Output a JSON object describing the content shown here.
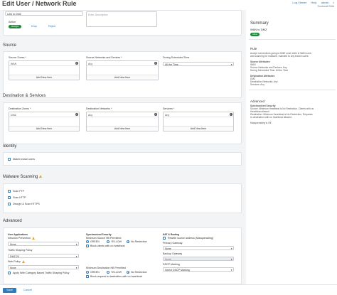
{
  "header": {
    "title": "Edit User / Network Rule",
    "links": [
      "Log Viewer",
      "Help",
      "admin"
    ],
    "subtitle": "Sonicwall SMA"
  },
  "top": {
    "description_placeholder": "Enter Description",
    "name_value": "LAN to DMZ",
    "action_label": "Action",
    "actions": [
      "Accept",
      "Drop",
      "Reject"
    ]
  },
  "source": {
    "title": "Source",
    "zones_label": "Source Zones *",
    "zones_value": "WAN",
    "networks_label": "Source Networks and Devices *",
    "networks_value": "Any",
    "schedule_label": "During Scheduled Time",
    "schedule_value": "All the Time",
    "add_item": "Add New Item"
  },
  "destination": {
    "title": "Destination & Services",
    "zones_label": "Destination Zones *",
    "zones_value": "DMZ",
    "networks_label": "Destination Networks *",
    "networks_value": "Any",
    "services_label": "Services *",
    "services_value": "Any",
    "add_item": "Add New Item"
  },
  "identity": {
    "title": "Identity",
    "match_label": "Match known users"
  },
  "malware": {
    "title": "Malware Scanning",
    "items": [
      "Scan FTP",
      "Scan HTTP",
      "Decrypt & Scan HTTPS"
    ]
  },
  "advanced": {
    "title": "Advanced",
    "user_apps": "User Applications",
    "intrusion_label": "Intrusion Prevention",
    "intrusion_value": "None",
    "traffic_label": "Traffic Shaping Policy",
    "traffic_value": "DMZ 20",
    "web_label": "Web Policy",
    "web_value": "None",
    "apply_web": "Apply Web Category Based Traffic Shaping Policy",
    "sync_security": "Synchronized Security",
    "min_source": "Minimum Source HB Permitted",
    "min_dest": "Minimum Destination HB Permitted",
    "hb_options": [
      "GREEN",
      "YELLOW",
      "No Restriction"
    ],
    "block_clients": "Block clients with no heartbeat",
    "block_request": "Block request to destination with no heartbeat",
    "nat_routing": "NAT & Routing",
    "rewrite": "Rewrite source address (Masquerading)",
    "primary_gw_label": "Primary Gateway",
    "primary_gw_value": "None",
    "backup_gw_label": "Backup Gateway",
    "backup_gw_value": "None",
    "dscp_label": "DSCP Marking",
    "dscp_value": "Select DSCP Marking"
  },
  "summary": {
    "title": "Summary",
    "name": "WAN to DMZ",
    "badge": "Allow",
    "rule_title": "Rule",
    "rule_text": [
      "Accept connections going to DMZ zone while in WAN zone,",
      "and scanning for malware, matched to any known users.",
      "",
      "Source Attributes",
      "WAN",
      "Source Networks and Devices: Any",
      "During Scheduled Time: All the Time",
      "",
      "Destination Attributes",
      "DMZ",
      "Destination Networks: Any",
      "Services: Any"
    ],
    "advanced_title": "Advanced",
    "advanced_text": [
      "Synchronized Security",
      "Source: Minimum Heartbeat is No Restriction, Clients with no",
      "Heartbeat allowed",
      "Destination: Minimum Heartbeat is No Restriction, Requests",
      "to destination with no heartbeat allowed",
      "",
      "Masquerading is Off"
    ]
  },
  "footer": {
    "save": "Save",
    "cancel": "Cancel"
  },
  "colors": {
    "accent": "#2e7bbd",
    "allow_green": "#1d8a3a",
    "warning": "#f0a030"
  }
}
